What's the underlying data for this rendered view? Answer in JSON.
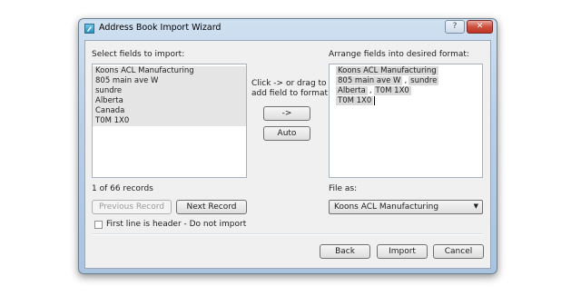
{
  "window": {
    "title": "Address Book Import Wizard",
    "help_label": "?",
    "close_label": "✕"
  },
  "left": {
    "heading": "Select fields to import:",
    "items": [
      "Koons ACL Manufacturing",
      "805 main ave W",
      "sundre",
      "Alberta",
      "Canada",
      "T0M 1X0"
    ],
    "record_count": "1 of 66 records",
    "prev_label": "Previous Record",
    "next_label": "Next Record",
    "header_checkbox_label": "First line is header - Do not import"
  },
  "middle": {
    "hint_line1": "Click -> or drag to",
    "hint_line2": "add field to format.",
    "add_label": "->",
    "auto_label": "Auto"
  },
  "right": {
    "heading": "Arrange fields into desired format:",
    "line1_tok1": "Koons ACL Manufacturing",
    "line2_tok1": "805 main ave W",
    "line2_sep": ",",
    "line2_tok2": "sundre",
    "line3_tok1": "Alberta",
    "line3_sep": ",",
    "line3_tok2": "T0M 1X0",
    "line4_tok1": "T0M 1X0",
    "file_as_label": "File as:",
    "file_as_value": "Koons ACL Manufacturing"
  },
  "footer": {
    "back_label": "Back",
    "import_label": "Import",
    "cancel_label": "Cancel"
  }
}
